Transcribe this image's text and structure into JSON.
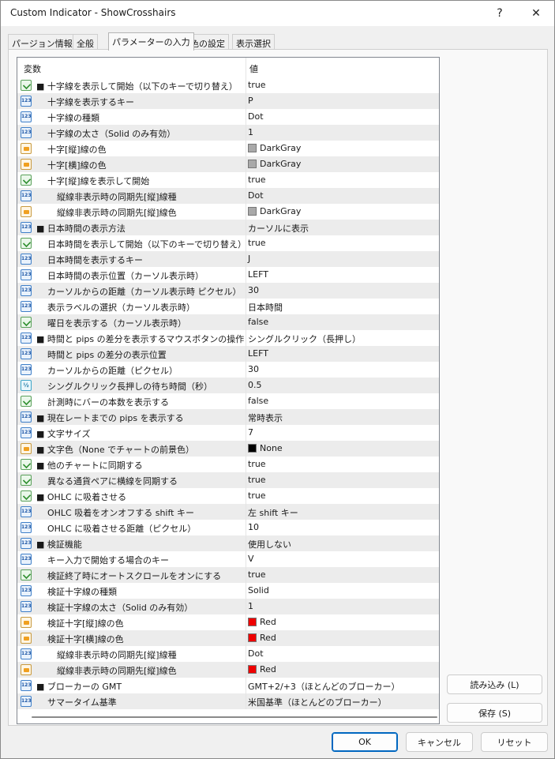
{
  "window": {
    "title": "Custom Indicator - ShowCrosshairs",
    "help_glyph": "?",
    "close_glyph": "✕"
  },
  "tabs": [
    "パージョン情報",
    "全般",
    "パラメーターの入力",
    "色の設定",
    "表示選択"
  ],
  "grid": {
    "header_variable": "変数",
    "header_value": "値",
    "rows": [
      {
        "icon": "bool",
        "indent": 1,
        "label": "■ 十字線を表示して開始（以下のキーで切り替え）",
        "value": "true"
      },
      {
        "icon": "num",
        "indent": 2,
        "label": "十字線を表示するキー",
        "value": "P"
      },
      {
        "icon": "num",
        "indent": 2,
        "label": "十字線の種類",
        "value": "Dot"
      },
      {
        "icon": "num",
        "indent": 2,
        "label": "十字線の太さ（Solid のみ有効）",
        "value": "1"
      },
      {
        "icon": "color",
        "indent": 2,
        "label": "十字[縦]線の色",
        "value": "DarkGray",
        "swatch": "#a9a9a9"
      },
      {
        "icon": "color",
        "indent": 2,
        "label": "十字[横]線の色",
        "value": "DarkGray",
        "swatch": "#a9a9a9"
      },
      {
        "icon": "bool",
        "indent": 2,
        "label": "十字[縦]線を表示して開始",
        "value": "true"
      },
      {
        "icon": "num",
        "indent": 3,
        "label": "縦線非表示時の同期先[縦]線種",
        "value": "Dot"
      },
      {
        "icon": "color",
        "indent": 3,
        "label": "縦線非表示時の同期先[縦]線色",
        "value": "DarkGray",
        "swatch": "#a9a9a9"
      },
      {
        "icon": "num",
        "indent": 1,
        "label": "■ 日本時間の表示方法",
        "value": "カーソルに表示"
      },
      {
        "icon": "bool",
        "indent": 2,
        "label": "日本時間を表示して開始（以下のキーで切り替え）",
        "value": "true"
      },
      {
        "icon": "num",
        "indent": 2,
        "label": "日本時間を表示するキー",
        "value": "J"
      },
      {
        "icon": "num",
        "indent": 2,
        "label": "日本時間の表示位置（カーソル表示時）",
        "value": "LEFT"
      },
      {
        "icon": "num",
        "indent": 2,
        "label": "カーソルからの距離（カーソル表示時 ピクセル）",
        "value": "30"
      },
      {
        "icon": "num",
        "indent": 2,
        "label": "表示ラベルの選択（カーソル表示時）",
        "value": "日本時間"
      },
      {
        "icon": "bool",
        "indent": 2,
        "label": "曜日を表示する（カーソル表示時）",
        "value": "false"
      },
      {
        "icon": "num",
        "indent": 1,
        "label": "■ 時間と pips の差分を表示するマウスボタンの操作",
        "value": "シングルクリック（長押し）"
      },
      {
        "icon": "num",
        "indent": 2,
        "label": "時間と pips の差分の表示位置",
        "value": "LEFT"
      },
      {
        "icon": "num",
        "indent": 2,
        "label": "カーソルからの距離（ピクセル）",
        "value": "30"
      },
      {
        "icon": "frac",
        "indent": 2,
        "label": "シングルクリック長押しの待ち時間（秒）",
        "value": "0.5"
      },
      {
        "icon": "bool",
        "indent": 2,
        "label": "計測時にバーの本数を表示する",
        "value": "false"
      },
      {
        "icon": "num",
        "indent": 1,
        "label": "■ 現在レートまでの pips を表示する",
        "value": "常時表示"
      },
      {
        "icon": "num",
        "indent": 1,
        "label": "■ 文字サイズ",
        "value": "7"
      },
      {
        "icon": "color",
        "indent": 1,
        "label": "■ 文字色（None でチャートの前景色）",
        "value": "None",
        "swatch": "#000000"
      },
      {
        "icon": "bool",
        "indent": 1,
        "label": "■ 他のチャートに同期する",
        "value": "true"
      },
      {
        "icon": "bool",
        "indent": 2,
        "label": "異なる通貨ペアに横線を同期する",
        "value": "true"
      },
      {
        "icon": "bool",
        "indent": 1,
        "label": "■ OHLC に吸着させる",
        "value": "true"
      },
      {
        "icon": "num",
        "indent": 2,
        "label": "OHLC 吸着をオンオフする shift キー",
        "value": "左 shift キー"
      },
      {
        "icon": "num",
        "indent": 2,
        "label": "OHLC に吸着させる距離（ピクセル）",
        "value": "10"
      },
      {
        "icon": "num",
        "indent": 1,
        "label": "■ 検証機能",
        "value": "使用しない"
      },
      {
        "icon": "num",
        "indent": 2,
        "label": "キー入力で開始する場合のキー",
        "value": "V"
      },
      {
        "icon": "bool",
        "indent": 2,
        "label": "検証終了時にオートスクロールをオンにする",
        "value": "true"
      },
      {
        "icon": "num",
        "indent": 2,
        "label": "検証十字線の種類",
        "value": "Solid"
      },
      {
        "icon": "num",
        "indent": 2,
        "label": "検証十字線の太さ（Solid のみ有効）",
        "value": "1"
      },
      {
        "icon": "color",
        "indent": 2,
        "label": "検証十字[縦]線の色",
        "value": "Red",
        "swatch": "#ee0000"
      },
      {
        "icon": "color",
        "indent": 2,
        "label": "検証十字[横]線の色",
        "value": "Red",
        "swatch": "#ee0000"
      },
      {
        "icon": "num",
        "indent": 3,
        "label": "縦線非表示時の同期先[縦]線種",
        "value": "Dot"
      },
      {
        "icon": "color",
        "indent": 3,
        "label": "縦線非表示時の同期先[縦]線色",
        "value": "Red",
        "swatch": "#ee0000"
      },
      {
        "icon": "num",
        "indent": 1,
        "label": "■ ブローカーの GMT",
        "value": "GMT+2/+3（ほとんどのブローカー）"
      },
      {
        "icon": "num",
        "indent": 2,
        "label": "サマータイム基準",
        "value": "米国基準（ほとんどのブローカー）"
      }
    ]
  },
  "side_buttons": {
    "load": "読み込み (L)",
    "save": "保存 (S)"
  },
  "footer_buttons": {
    "ok": "OK",
    "cancel": "キャンセル",
    "reset": "リセット"
  },
  "colors": {
    "accent": "#0067c0",
    "row_shaded": "#ececec"
  }
}
